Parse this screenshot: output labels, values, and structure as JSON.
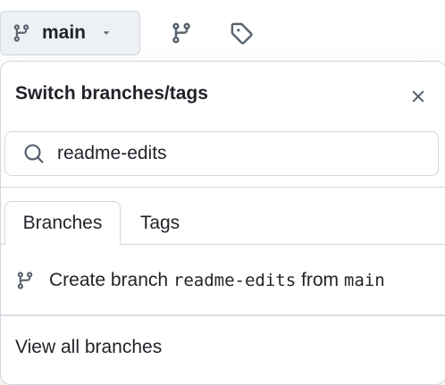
{
  "branch_button": {
    "label": "main"
  },
  "popover": {
    "title": "Switch branches/tags",
    "search": {
      "value": "readme-edits",
      "placeholder": ""
    },
    "tabs": [
      {
        "label": "Branches",
        "active": true
      },
      {
        "label": "Tags",
        "active": false
      }
    ],
    "create_branch": {
      "prefix": "Create branch",
      "branch_name": "readme-edits",
      "middle": "from",
      "source": "main"
    },
    "footer_link": "View all branches"
  },
  "icons": {
    "branch": "git-branch-icon",
    "caret": "triangle-down-icon",
    "tag": "tag-icon",
    "close": "x-icon",
    "search": "search-icon"
  },
  "colors": {
    "text": "#1f2328",
    "border": "#d0d7de",
    "button_bg": "#eef1f4"
  }
}
